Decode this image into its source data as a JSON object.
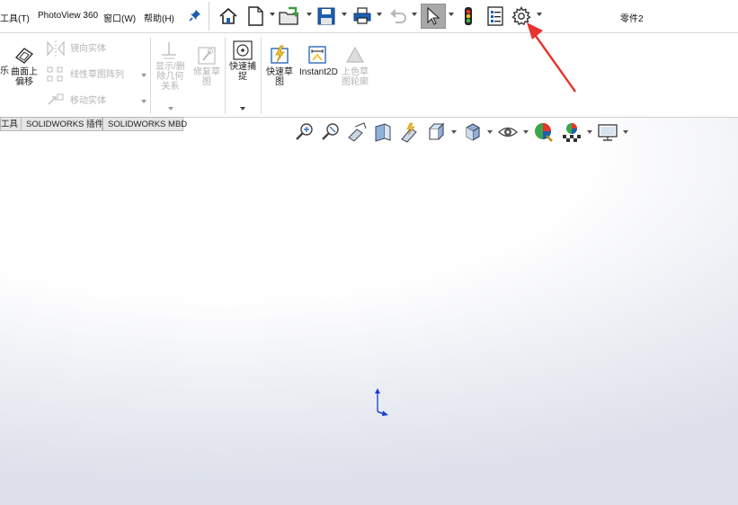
{
  "menubar": {
    "items": [
      "工具(T)",
      "PhotoView 360",
      "窗口(W)",
      "帮助(H)"
    ],
    "document_title": "零件2"
  },
  "ribbon": {
    "cut_label": "乐",
    "surface_offset": "曲面上\n偏移",
    "mirror_entity": "镜向实体",
    "linear_sketch_pattern": "线性草图阵列",
    "move_entity": "移动实体",
    "display_delete_relations": "显示/删\n除几何\n关系",
    "repair_sketch": "修复草\n图",
    "quick_snaps": "快速捕\n捉",
    "rapid_sketch": "快速草\n图",
    "instant2d": "Instant2D",
    "shaded_sketch_contours": "上色草\n图轮廓"
  },
  "tabs": [
    "工具",
    "SOLIDWORKS 插件",
    "SOLIDWORKS MBD"
  ],
  "colors": {
    "accent_blue": "#1c5fb0",
    "annotation_red": "#e8322c",
    "triad_blue": "#1a3fcf"
  }
}
